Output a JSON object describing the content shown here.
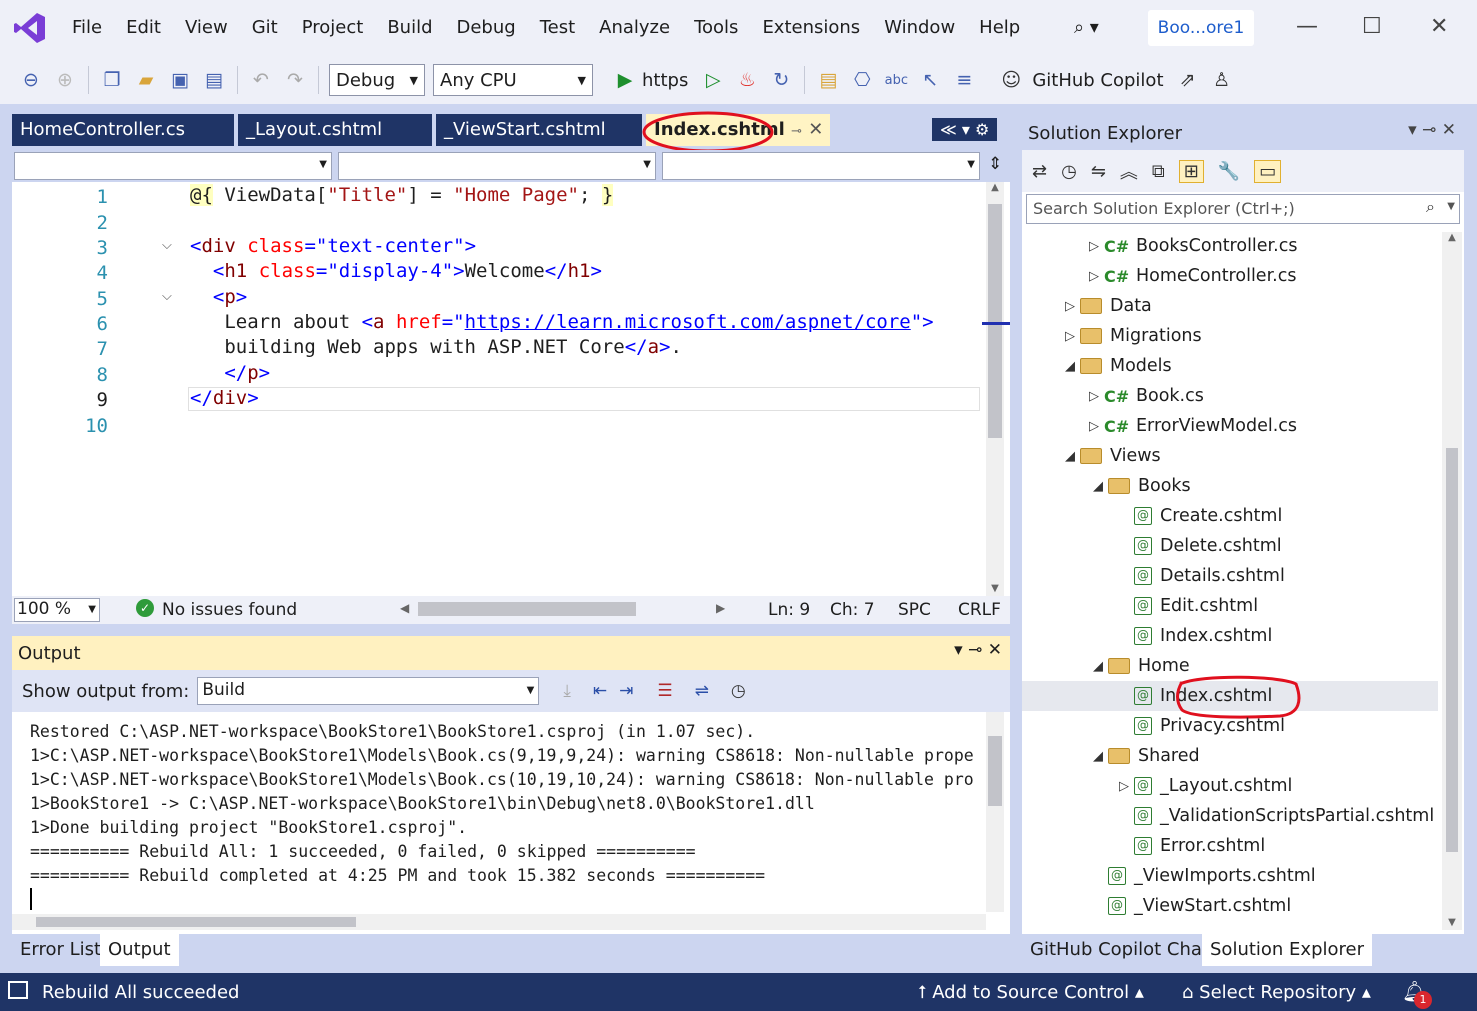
{
  "menu": [
    "File",
    "Edit",
    "View",
    "Git",
    "Project",
    "Build",
    "Debug",
    "Test",
    "Analyze",
    "Tools",
    "Extensions",
    "Window",
    "Help"
  ],
  "solution_name": "Boo...ore1",
  "toolbar": {
    "config": "Debug",
    "platform": "Any CPU",
    "run_target": "https",
    "copilot": "GitHub Copilot"
  },
  "tabs": [
    "HomeController.cs",
    "_Layout.cshtml",
    "_ViewStart.cshtml",
    "Index.cshtml"
  ],
  "editor": {
    "line_numbers": [
      "1",
      "2",
      "3",
      "4",
      "5",
      "6",
      "7",
      "8",
      "9",
      "10"
    ],
    "zoom": "100 %",
    "issues": "No issues found",
    "ln": "Ln: 9",
    "ch": "Ch: 7",
    "spc": "SPC",
    "crlf": "CRLF"
  },
  "output": {
    "title": "Output",
    "show_from_label": "Show output from:",
    "source": "Build",
    "lines": [
      "Restored C:\\ASP.NET-workspace\\BookStore1\\BookStore1.csproj (in 1.07 sec).",
      "1>C:\\ASP.NET-workspace\\BookStore1\\Models\\Book.cs(9,19,9,24): warning CS8618: Non-nullable prope",
      "1>C:\\ASP.NET-workspace\\BookStore1\\Models\\Book.cs(10,19,10,24): warning CS8618: Non-nullable pro",
      "1>BookStore1 -> C:\\ASP.NET-workspace\\BookStore1\\bin\\Debug\\net8.0\\BookStore1.dll",
      "1>Done building project \"BookStore1.csproj\".",
      "========== Rebuild All: 1 succeeded, 0 failed, 0 skipped ==========",
      "========== Rebuild completed at 4:25 PM and took 15.382 seconds =========="
    ]
  },
  "bottom_tabs": [
    "Error List",
    "Output"
  ],
  "solution_explorer": {
    "title": "Solution Explorer",
    "search_placeholder": "Search Solution Explorer (Ctrl+;)",
    "items": [
      "BooksController.cs",
      "HomeController.cs",
      "Data",
      "Migrations",
      "Models",
      "Book.cs",
      "ErrorViewModel.cs",
      "Views",
      "Books",
      "Create.cshtml",
      "Delete.cshtml",
      "Details.cshtml",
      "Edit.cshtml",
      "Index.cshtml",
      "Home",
      "Index.cshtml",
      "Privacy.cshtml",
      "Shared",
      "_Layout.cshtml",
      "_ValidationScriptsPartial.cshtml",
      "Error.cshtml",
      "_ViewImports.cshtml",
      "_ViewStart.cshtml"
    ],
    "bottom_tabs": [
      "GitHub Copilot Chat",
      "Solution Explorer"
    ]
  },
  "status": {
    "message": "Rebuild All succeeded",
    "source_control": "Add to Source Control",
    "repository": "Select Repository",
    "notifications": "1"
  },
  "colors": {
    "accent": "#1f3466",
    "annotation": "#e0101e"
  }
}
